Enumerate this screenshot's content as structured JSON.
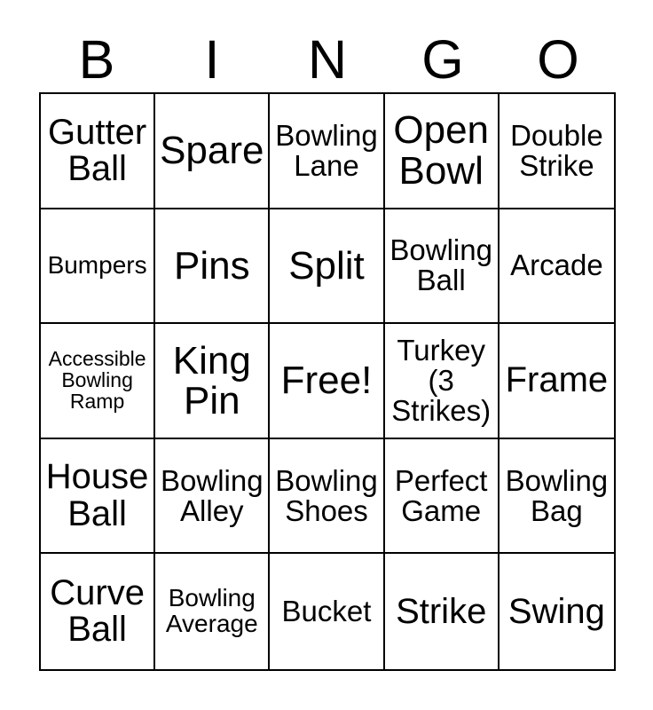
{
  "card": {
    "title": "BINGO",
    "header_letters": [
      "B",
      "I",
      "N",
      "G",
      "O"
    ],
    "colors": {
      "background": "#ffffff",
      "text": "#000000",
      "border": "#000000"
    },
    "grid_size": "5x5",
    "free_space": "Free!",
    "rows": [
      [
        {
          "text": "Gutter\nBall",
          "size": "lg"
        },
        {
          "text": "Spare",
          "size": "xl"
        },
        {
          "text": "Bowling\nLane",
          "size": "md"
        },
        {
          "text": "Open\nBowl",
          "size": "xl"
        },
        {
          "text": "Double\nStrike",
          "size": "md"
        }
      ],
      [
        {
          "text": "Bumpers",
          "size": "sm"
        },
        {
          "text": "Pins",
          "size": "xl"
        },
        {
          "text": "Split",
          "size": "xl"
        },
        {
          "text": "Bowling\nBall",
          "size": "md"
        },
        {
          "text": "Arcade",
          "size": "md"
        }
      ],
      [
        {
          "text": "Accessible\nBowling\nRamp",
          "size": "xs"
        },
        {
          "text": "King\nPin",
          "size": "xl"
        },
        {
          "text": "Free!",
          "size": "xl"
        },
        {
          "text": "Turkey\n(3\nStrikes)",
          "size": "md"
        },
        {
          "text": "Frame",
          "size": "lg"
        }
      ],
      [
        {
          "text": "House\nBall",
          "size": "lg"
        },
        {
          "text": "Bowling\nAlley",
          "size": "md"
        },
        {
          "text": "Bowling\nShoes",
          "size": "md"
        },
        {
          "text": "Perfect\nGame",
          "size": "md"
        },
        {
          "text": "Bowling\nBag",
          "size": "md"
        }
      ],
      [
        {
          "text": "Curve\nBall",
          "size": "lg"
        },
        {
          "text": "Bowling\nAverage",
          "size": "sm"
        },
        {
          "text": "Bucket",
          "size": "md"
        },
        {
          "text": "Strike",
          "size": "lg"
        },
        {
          "text": "Swing",
          "size": "lg"
        }
      ]
    ]
  }
}
